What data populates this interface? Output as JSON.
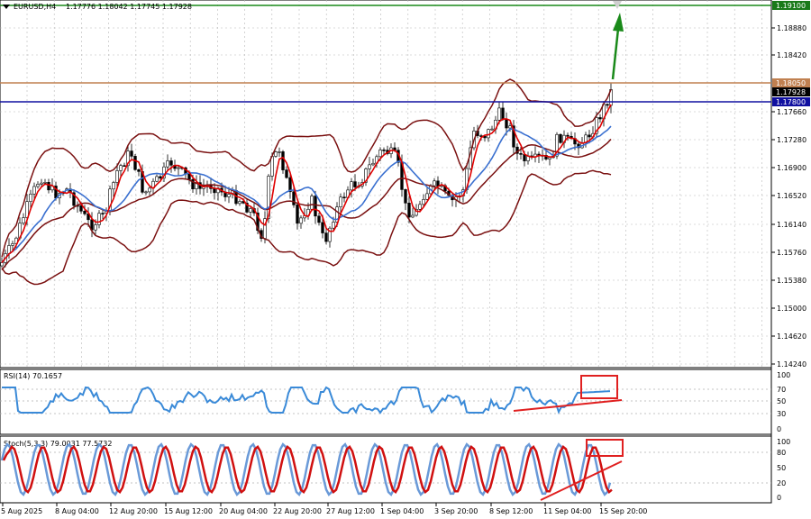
{
  "header": {
    "symbol": "EURUSD,H4",
    "ohlc": "1.17776 1.18042 1.17745 1.17928"
  },
  "price_axis": {
    "ticks": [
      "1.18880",
      "1.18420",
      "1.17660",
      "1.17280",
      "1.16900",
      "1.16520",
      "1.16140",
      "1.15760",
      "1.15380",
      "1.15000",
      "1.14620",
      "1.14240"
    ],
    "tags": [
      {
        "text": "1.19100",
        "bg": "#1a7a1a"
      },
      {
        "text": "1.18050",
        "bg": "#c08050"
      },
      {
        "text": "1.17928",
        "bg": "#000000"
      },
      {
        "text": "1.17800",
        "bg": "#1010a0"
      }
    ]
  },
  "time_axis": [
    "5 Aug 2025",
    "8 Aug 04:00",
    "12 Aug 20:00",
    "15 Aug 12:00",
    "20 Aug 04:00",
    "22 Aug 20:00",
    "27 Aug 12:00",
    "1 Sep 04:00",
    "3 Sep 20:00",
    "8 Sep 12:00",
    "11 Sep 04:00",
    "15 Sep 20:00"
  ],
  "rsi": {
    "label": "RSI(14) 70.1657",
    "ticks": [
      "100",
      "70",
      "50",
      "30",
      "0"
    ]
  },
  "stoch": {
    "label": "Stoch(5,3,3) 79.0031 77.5732",
    "ticks": [
      "100",
      "80",
      "50",
      "20",
      "0"
    ]
  },
  "colors": {
    "bull_candle": "#000000",
    "bear_candle": "#000000",
    "bands": "#7a1010",
    "ma_fast": "#e00000",
    "ma_slow": "#3a70d0",
    "rsi_line": "#3a8ad8",
    "stoch_main": "#6a9ad8",
    "stoch_signal": "#d01010",
    "target_line": "#1a8a1a",
    "resistance_line": "#c08050",
    "support_line": "#1010a0",
    "annotation": "#e02020"
  },
  "icons": [
    "triangle-down-icon",
    "arrow-up-icon"
  ]
}
